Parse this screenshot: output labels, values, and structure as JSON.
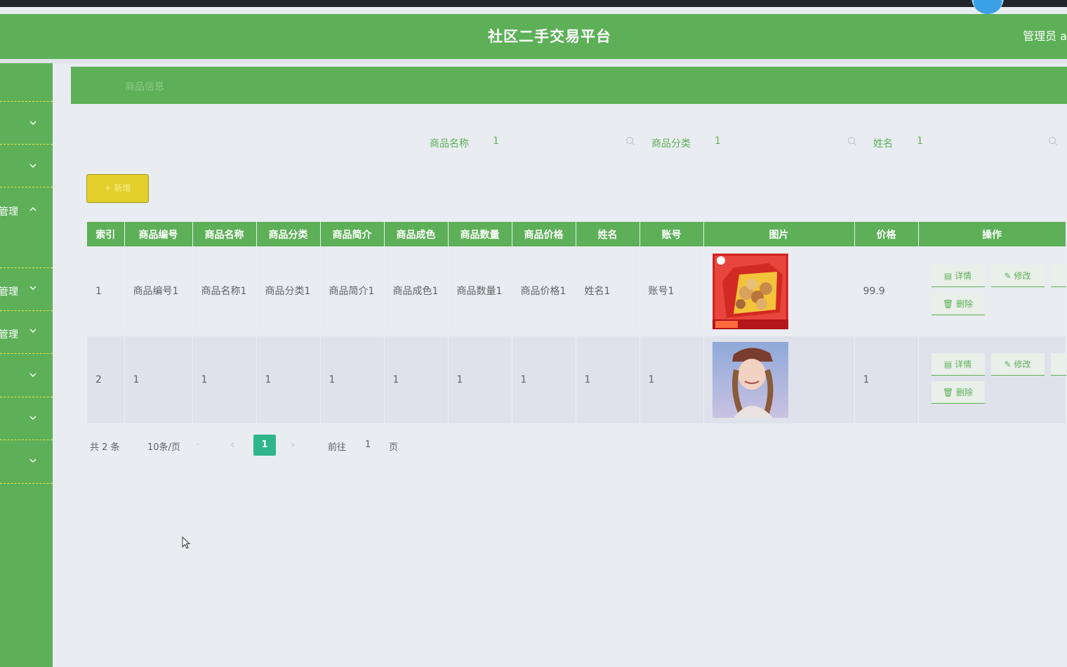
{
  "app": {
    "title": "社区二手交易平台",
    "user_label": "管理员 a"
  },
  "breadcrumb": "商品信息",
  "sidebar": {
    "items": [
      {
        "label": "",
        "chevron": "down"
      },
      {
        "label": "",
        "chevron": "down"
      },
      {
        "label": "管理",
        "chevron": "up"
      },
      {
        "label": "管理",
        "chevron": "down"
      },
      {
        "label": "管理",
        "chevron": "down"
      },
      {
        "label": "",
        "chevron": "down"
      },
      {
        "label": "",
        "chevron": "down"
      },
      {
        "label": "",
        "chevron": "down"
      }
    ]
  },
  "search": {
    "fields": [
      {
        "label": "商品名称",
        "value": "1",
        "icon": "search-icon"
      },
      {
        "label": "商品分类",
        "value": "1",
        "icon": "search-icon"
      },
      {
        "label": "姓名",
        "value": "1",
        "icon": "search-icon"
      }
    ]
  },
  "toolbar": {
    "add_label": "+ 新增"
  },
  "table": {
    "columns": [
      "索引",
      "商品编号",
      "商品名称",
      "商品分类",
      "商品简介",
      "商品成色",
      "商品数量",
      "商品价格",
      "姓名",
      "账号",
      "图片",
      "价格",
      "操作"
    ],
    "rows": [
      {
        "index": "1",
        "code": "商品编号1",
        "name": "商品名称1",
        "category": "商品分类1",
        "intro": "商品简介1",
        "condition": "商品成色1",
        "quantity": "商品数量1",
        "price_field": "商品价格1",
        "person": "姓名1",
        "account": "账号1",
        "image": "snack-gift-box-photo",
        "price": "99.9"
      },
      {
        "index": "2",
        "code": "1",
        "name": "1",
        "category": "1",
        "intro": "1",
        "condition": "1",
        "quantity": "1",
        "price_field": "1",
        "person": "1",
        "account": "1",
        "image": "woman-in-cap-photo",
        "price": "1"
      }
    ],
    "actions": {
      "detail": "详情",
      "edit": "修改",
      "delete": "删除"
    }
  },
  "pagination": {
    "total": "共 2 条",
    "page_size": "10条/页",
    "current_page": "1",
    "goto_label": "前往",
    "goto_value": "1",
    "goto_unit": "页"
  },
  "colors": {
    "primary_green": "#5db058",
    "add_button_yellow": "#e3cf2c",
    "active_page_teal": "#2fb68a",
    "background": "#e9edf1"
  }
}
